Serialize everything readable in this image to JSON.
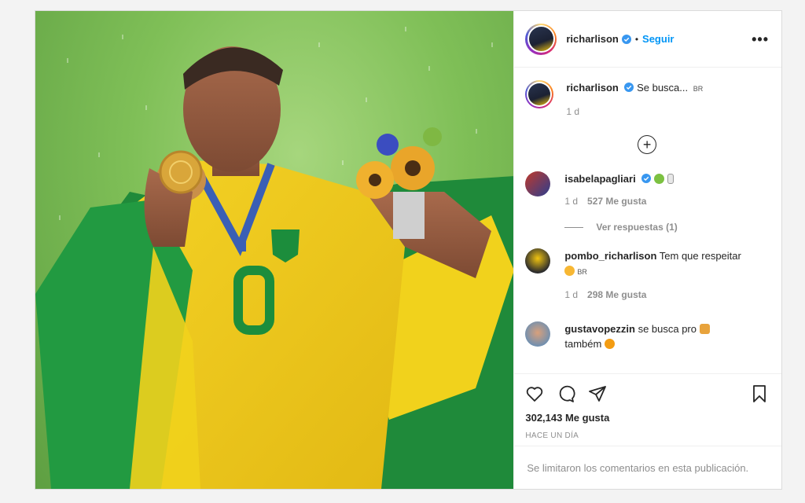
{
  "header": {
    "username": "richarlison",
    "separator": "•",
    "follow_label": "Seguir",
    "more_label": "•••"
  },
  "caption": {
    "username": "richarlison",
    "text": "Se busca...",
    "flag": "BR",
    "time": "1 d"
  },
  "load_more_label": "+",
  "comments": [
    {
      "username": "isabelapagliari",
      "text": "",
      "time": "1 d",
      "likes": "527 Me gusta",
      "replies": "Ver respuestas (1)"
    },
    {
      "username": "pombo_richarlison",
      "text": "Tem que respeitar",
      "flag": "BR",
      "time": "1 d",
      "likes": "298 Me gusta"
    },
    {
      "username": "gustavopezzin",
      "text": "se busca pro",
      "text2": "também"
    }
  ],
  "likes": "302,143 Me gusta",
  "posted_ago": "HACE UN DÍA",
  "comments_limited": "Se limitaron los comentarios en esta publicación.",
  "colors": {
    "accent": "#0095f6",
    "verified": "#3897f0",
    "muted": "#8e8e8e"
  },
  "icons": [
    "verified-icon",
    "heart-icon",
    "comment-icon",
    "share-icon",
    "bookmark-icon",
    "plus-circle-icon",
    "more-icon"
  ]
}
